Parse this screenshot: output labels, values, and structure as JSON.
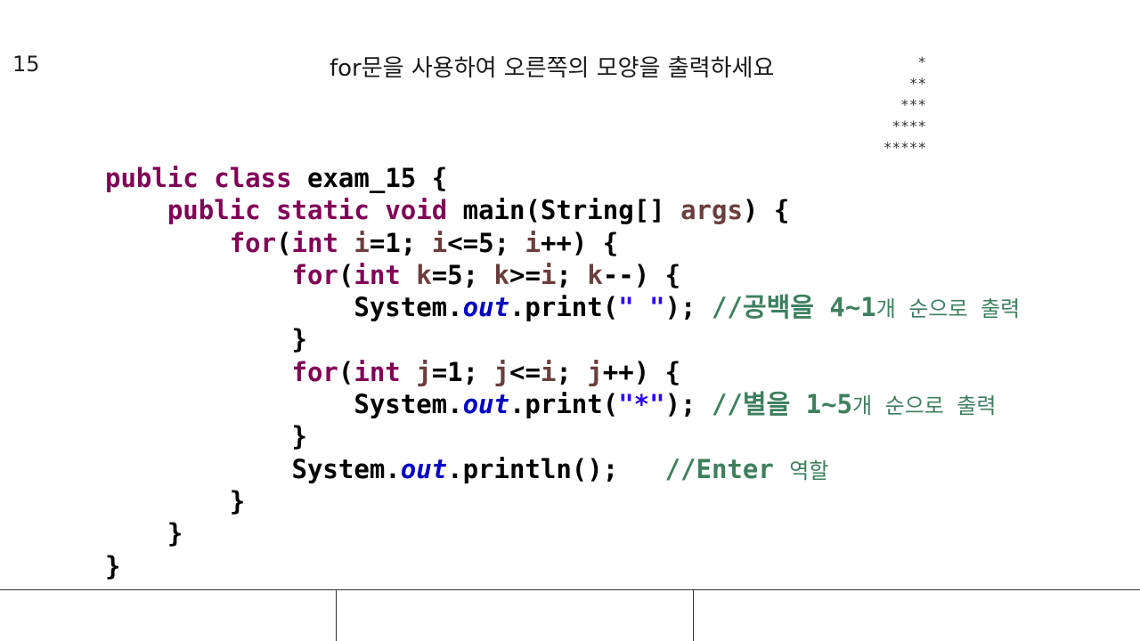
{
  "slide": {
    "number": "15",
    "title": "for문을 사용하여 오른쪽의 모양을 출력하세요"
  },
  "star_pattern": [
    "*",
    "**",
    "***",
    "****",
    "*****"
  ],
  "code": {
    "l1_kw1": "public",
    "l1_kw2": "class",
    "l1_rest": "exam_15 {",
    "l2_kw1": "public",
    "l2_kw2": "static",
    "l2_kw3": "void",
    "l2_mid": "main(String[] ",
    "l2_var": "args",
    "l2_end": ") {",
    "l3_kw1": "for",
    "l3_p1": "(",
    "l3_kw2": "int",
    "l3_sp": " ",
    "l3_v1": "i",
    "l3_t1": "=1; ",
    "l3_v2": "i",
    "l3_t2": "<=5; ",
    "l3_v3": "i",
    "l3_t3": "++) {",
    "l4_kw1": "for",
    "l4_p1": "(",
    "l4_kw2": "int",
    "l4_sp": " ",
    "l4_v1": "k",
    "l4_t1": "=5; ",
    "l4_v2": "k",
    "l4_t2": ">=",
    "l4_v3": "i",
    "l4_t3": "; ",
    "l4_v4": "k",
    "l4_t4": "--) {",
    "l5_a": "System.",
    "l5_field": "out",
    "l5_b": ".print(",
    "l5_str": "\" \"",
    "l5_c": "); ",
    "l5_cmt1": "//공백을 ",
    "l5_cmt2": "4~1",
    "l5_cmt3": "개 순으로 출력",
    "l6": "}",
    "l7_kw1": "for",
    "l7_p1": "(",
    "l7_kw2": "int",
    "l7_sp": " ",
    "l7_v1": "j",
    "l7_t1": "=1; ",
    "l7_v2": "j",
    "l7_t2": "<=",
    "l7_v3": "i",
    "l7_t3": "; ",
    "l7_v4": "j",
    "l7_t4": "++) {",
    "l8_a": "System.",
    "l8_field": "out",
    "l8_b": ".print(",
    "l8_str": "\"*\"",
    "l8_c": "); ",
    "l8_cmt1": "//별을 ",
    "l8_cmt2": "1~5",
    "l8_cmt3": "개 순으로 출력",
    "l9": "}",
    "l10_a": "System.",
    "l10_field": "out",
    "l10_b": ".println();   ",
    "l10_cmt1": "//Enter ",
    "l10_cmt2": "역할",
    "l11": "}",
    "l12": "}",
    "l13": "}"
  },
  "colors": {
    "keyword": "#7f0055",
    "variable": "#6a3e3e",
    "field": "#0000c0",
    "string": "#2a00ff",
    "comment": "#3f7f5f"
  }
}
